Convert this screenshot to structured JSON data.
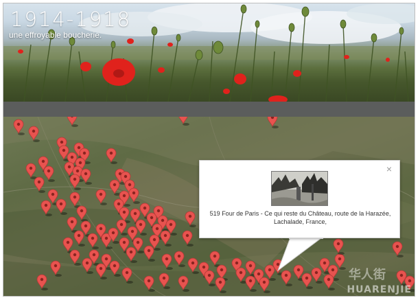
{
  "header": {
    "title": "1914-1918",
    "subtitle": "une effroyable boucherie."
  },
  "info_window": {
    "caption_line1": "519 Four de Paris - Ce qui reste du Château, route de la Harazée,",
    "caption_line2": "Lachalade, France,",
    "close_label": "×"
  },
  "watermark": {
    "text": "HUARENJIE",
    "logo_text": "华人街"
  },
  "colors": {
    "pin": "#e8534f",
    "pin_outline": "#b23a36",
    "poppy": "#e0221c",
    "strip": "#5b5d5c"
  },
  "icons": {
    "map_marker": "map-pin-icon",
    "close": "close-icon"
  }
}
